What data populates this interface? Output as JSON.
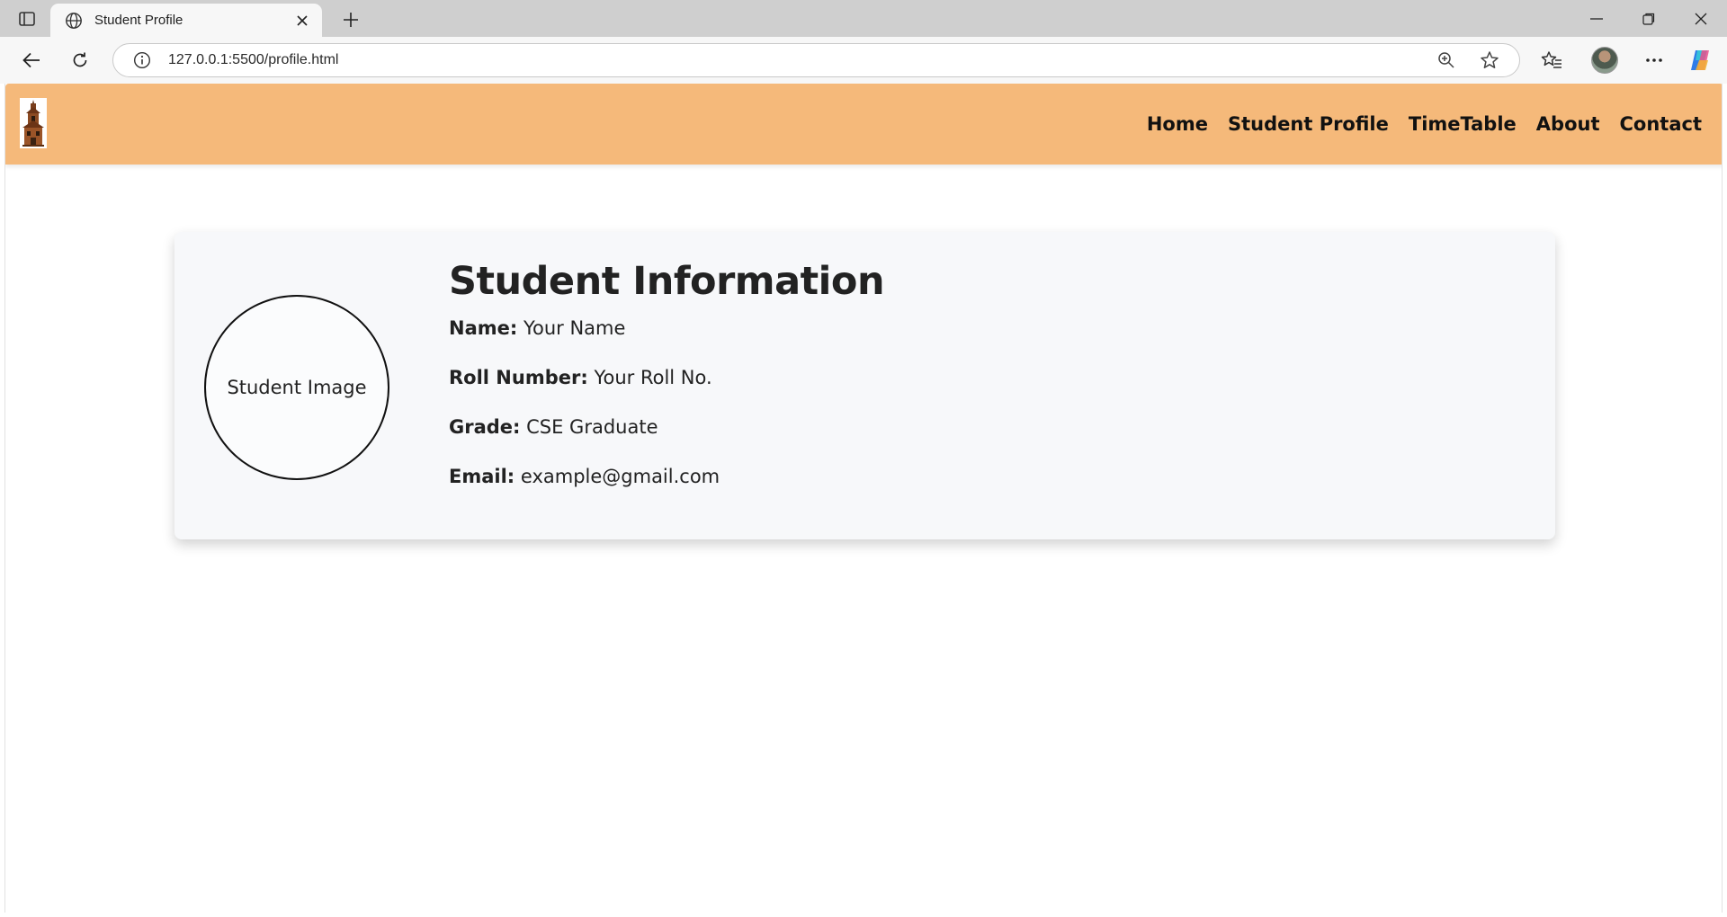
{
  "browser": {
    "tab_title": "Student Profile",
    "url": "127.0.0.1:5500/profile.html"
  },
  "navbar": {
    "logo_icon": "school-building-icon",
    "links": [
      {
        "label": "Home"
      },
      {
        "label": "Student Profile"
      },
      {
        "label": "TimeTable"
      },
      {
        "label": "About"
      },
      {
        "label": "Contact"
      }
    ],
    "background": "#f5b97a"
  },
  "profile": {
    "image_placeholder": "Student Image",
    "title": "Student Information",
    "fields": [
      {
        "label": "Name:",
        "value": "Your Name"
      },
      {
        "label": "Roll Number:",
        "value": "Your Roll No."
      },
      {
        "label": "Grade:",
        "value": "CSE Graduate"
      },
      {
        "label": "Email:",
        "value": "example@gmail.com"
      }
    ]
  }
}
